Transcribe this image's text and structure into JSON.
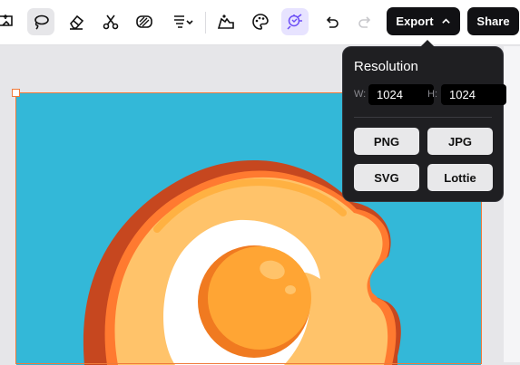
{
  "toolbar": {
    "tools": [
      {
        "name": "import-image-icon"
      },
      {
        "name": "lasso-icon",
        "selected": true
      },
      {
        "name": "eraser-icon"
      },
      {
        "name": "scissors-icon"
      },
      {
        "name": "remove-background-icon"
      },
      {
        "name": "layer-dropdown-icon"
      },
      {
        "name": "shapes-icon"
      },
      {
        "name": "palette-icon"
      },
      {
        "name": "magic-wand-icon",
        "active": true
      },
      {
        "name": "undo-icon"
      },
      {
        "name": "redo-icon",
        "disabled": true
      }
    ],
    "export_label": "Export",
    "share_label": "Share"
  },
  "export_panel": {
    "title": "Resolution",
    "width_label": "W:",
    "width_value": "1024",
    "height_label": "H:",
    "height_value": "1024",
    "formats": [
      "PNG",
      "JPG",
      "SVG",
      "Lottie"
    ]
  },
  "colors": {
    "accent_purple": "#6b4df6",
    "selection_orange": "#f07a3a",
    "canvas_bg": "#33b8d8",
    "toast_light": "#ffc36a",
    "toast_dark": "#c6471f",
    "yolk": "#ffa534"
  }
}
